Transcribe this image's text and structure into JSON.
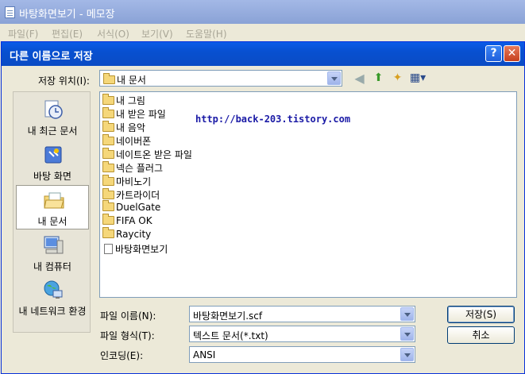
{
  "notepad": {
    "title": "바탕화면보기 - 메모장",
    "menu": [
      "파일(F)",
      "편집(E)",
      "서식(O)",
      "보기(V)",
      "도움말(H)"
    ]
  },
  "dialog": {
    "title": "다른 이름으로 저장",
    "help_glyph": "?",
    "close_glyph": "✕",
    "location_label": "저장 위치(I):",
    "location_value": "내 문서",
    "places": [
      "내 최근 문서",
      "바탕 화면",
      "내 문서",
      "내 컴퓨터",
      "내 네트워크 환경"
    ],
    "files": [
      "내 그림",
      "내 받은 파일",
      "내 음악",
      "네이버폰",
      "네이트온 받은 파일",
      "넥슨 플러그",
      "마비노기",
      "카트라이더",
      "DuelGate",
      "FIFA OK",
      "Raycity",
      "바탕화면보기"
    ],
    "watermark": "http://back-203.tistory.com",
    "filename_label": "파일 이름(N):",
    "filename_value": "바탕화면보기.scf",
    "filetype_label": "파일 형식(T):",
    "filetype_value": "텍스트 문서(*.txt)",
    "encoding_label": "인코딩(E):",
    "encoding_value": "ANSI",
    "save_button": "저장(S)",
    "cancel_button": "취소"
  }
}
